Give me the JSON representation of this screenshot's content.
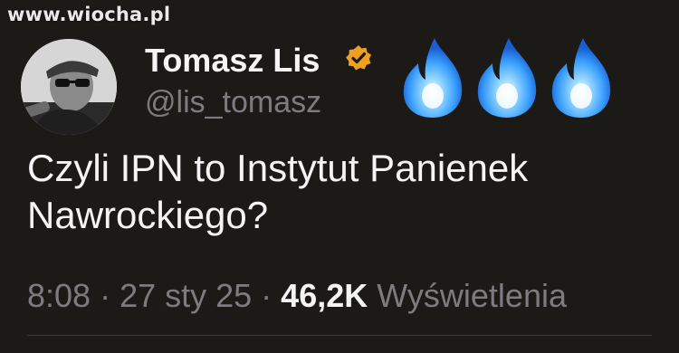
{
  "watermark": "www.wiocha.pl",
  "author": {
    "name": "Tomasz Lis",
    "handle": "@lis_tomasz",
    "verified_badge_color": "#f0a020"
  },
  "tweet": {
    "text": "Czyli IPN to Instytut Panienek Nawrockiego?"
  },
  "meta": {
    "time": "8:08",
    "separator1": " · ",
    "date": "27 sty 25",
    "separator2": " · ",
    "views_count": "46,2K",
    "views_label": " Wyświetlenia"
  },
  "icons": {
    "flame_color": "#3aa0ff"
  },
  "colors": {
    "background": "#1c1a17",
    "primary_text": "#f4f4f4",
    "secondary_text": "#7c7c80"
  }
}
